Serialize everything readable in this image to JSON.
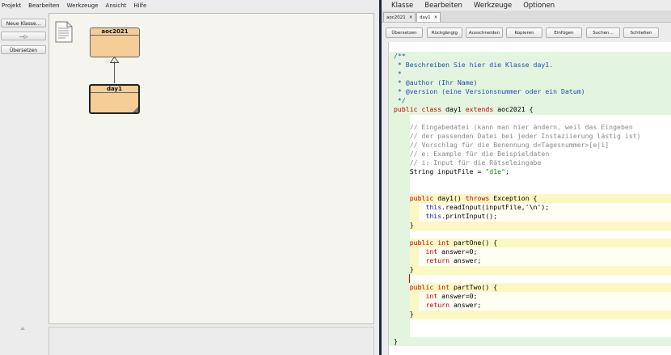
{
  "left_menu": [
    "Projekt",
    "Bearbeiten",
    "Werkzeuge",
    "Ansicht",
    "Hilfe"
  ],
  "right_menu": [
    "Klasse",
    "Bearbeiten",
    "Werkzeuge",
    "Optionen"
  ],
  "toolbar": {
    "new_class": "Neue Klasse...",
    "arrow": "—▷",
    "compile": "Übersetzen"
  },
  "diagram": {
    "parent_class": "aoc2021",
    "child_class": "day1"
  },
  "tabs": [
    {
      "label": "aoc2021",
      "close": "×"
    },
    {
      "label": "day1",
      "close": "×"
    }
  ],
  "editor_buttons": [
    "Übersetzen",
    "Rückgängig",
    "Ausschneiden",
    "Kopieren",
    "Einfügen",
    "Suchen...",
    "Schließen"
  ],
  "code": {
    "l1": "/**",
    "l2": " * Beschreiben Sie hier die Klasse day1.",
    "l3": " *",
    "l4": " * @author (Ihr Name)",
    "l5": " * @version (eine Versionsnummer oder ein Datum)",
    "l6": " */",
    "l7a": "public ",
    "l7b": "class",
    "l7c": " day1 ",
    "l7d": "extends",
    "l7e": " aoc2021 {",
    "c1": "    // Eingabedatei (kann man hier ändern, weil das Eingeben",
    "c2": "    // der passenden Datei bei jeder Instaziierung lästig ist)",
    "c3": "    // Vorschlag für die Benennung d<Tagesnummer>[e|i]",
    "c4": "    // e: Example für die Beispieldaten",
    "c5": "    // i: Input für die Rätseleingabe",
    "c6a": "    String inputFile = ",
    "c6b": "\"d1e\"",
    "c6c": ";",
    "k1a": "    public ",
    "k1b": "day1() ",
    "k1c": "throws",
    "k1d": " Exception {",
    "k2a": "        ",
    "k2b": "this",
    "k2c": ".readInput(inputFile,'\\n');",
    "k3a": "        ",
    "k3b": "this",
    "k3c": ".printInput();",
    "k4": "    }",
    "p1a": "    public ",
    "p1b": "int",
    "p1c": " partOne() {",
    "p2a": "        ",
    "p2b": "int",
    "p2c": " answer=0;",
    "p3a": "        ",
    "p3b": "return",
    "p3c": " answer;",
    "p4": "    }",
    "t1a": "    public ",
    "t1b": "int",
    "t1c": " partTwo() {",
    "t2a": "        ",
    "t2b": "int",
    "t2c": " answer=0;",
    "t3a": "        ",
    "t3b": "return",
    "t3c": " answer;",
    "t4": "    }",
    "end": "}"
  },
  "colors": {
    "class_fill": "#f4cd97",
    "comment_block": "#e3f5de",
    "method_block": "#fbf8c4",
    "keyword": "#c00000"
  }
}
